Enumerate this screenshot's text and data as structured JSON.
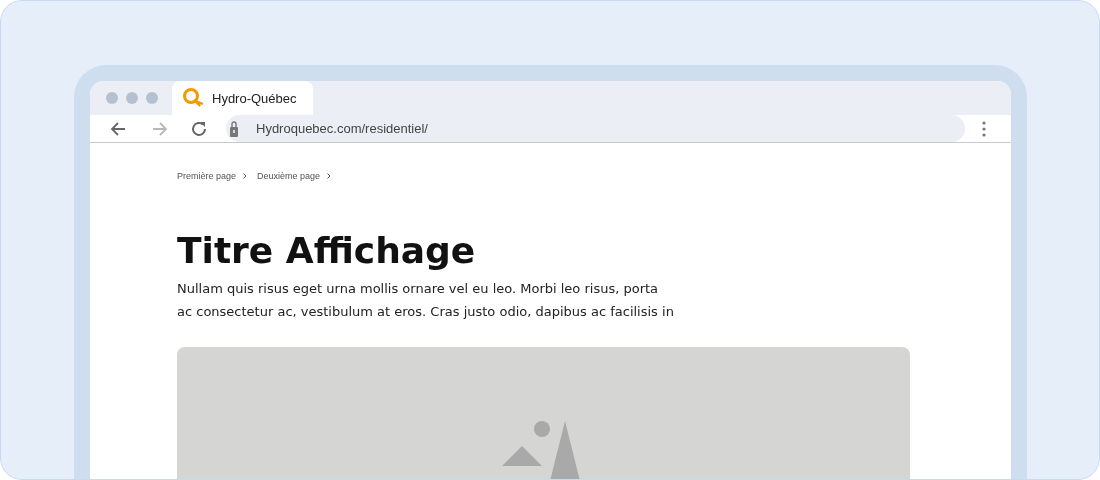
{
  "browser": {
    "tabs": [
      {
        "title": "Hydro-Québec",
        "selected": true
      }
    ],
    "nav_buttons": [
      {
        "kind": "back",
        "disabled": false
      },
      {
        "kind": "forward",
        "disabled": true
      },
      {
        "kind": "reload",
        "disabled": false
      }
    ],
    "address": "Hydroquebec.com/residentiel/"
  },
  "page": {
    "breadcrumbs": [
      "Première page",
      "Deuxième page"
    ],
    "title": "Titre Affichage",
    "paragraph": "Nullam quis risus eget urna mollis ornare vel eu leo. Morbi leo risus, porta ac consectetur ac, vestibulum at eros. Cras justo odio, dapibus ac facilisis in",
    "image": {
      "kind": "placeholder"
    }
  }
}
